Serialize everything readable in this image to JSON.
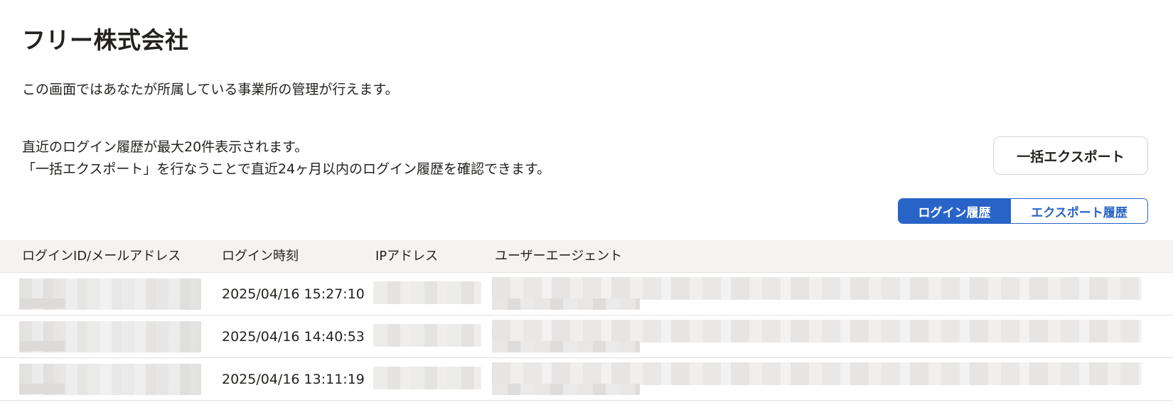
{
  "page": {
    "title": "フリー株式会社",
    "intro": "この画面ではあなたが所属している事業所の管理が行えます。",
    "notes": [
      "直近のログイン履歴が最大20件表示されます。",
      "「一括エクスポート」を行なうことで直近24ヶ月以内のログイン履歴を確認できます。"
    ]
  },
  "toolbar": {
    "export_label": "一括エクスポート"
  },
  "tabs": [
    {
      "label": "ログイン履歴",
      "active": true
    },
    {
      "label": "エクスポート履歴",
      "active": false
    }
  ],
  "table": {
    "headers": [
      "ログインID/メールアドレス",
      "ログイン時刻",
      "IPアドレス",
      "ユーザーエージェント"
    ],
    "rows": [
      {
        "login_time": "2025/04/16 15:27:10"
      },
      {
        "login_time": "2025/04/16 14:40:53"
      },
      {
        "login_time": "2025/04/16 13:11:19"
      }
    ]
  },
  "colors": {
    "accent": "#2864c8",
    "text": "#23221f",
    "header_bg": "#f5f3f2",
    "border": "#e4e1de"
  }
}
